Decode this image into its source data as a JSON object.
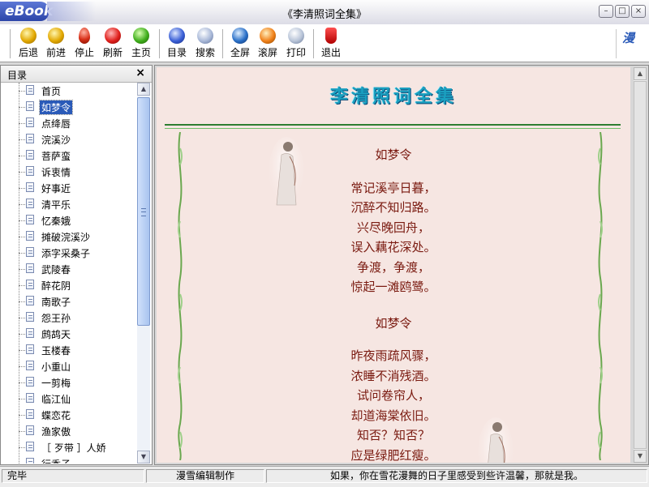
{
  "window": {
    "logo": "eBook",
    "title": "《李清照词全集》",
    "buttons": {
      "minimize": "–",
      "maximize": "□",
      "close": "×"
    }
  },
  "toolbar": {
    "items": [
      {
        "label": "后退",
        "icon": "back-icon"
      },
      {
        "label": "前进",
        "icon": "forward-icon"
      },
      {
        "label": "停止",
        "icon": "stop-icon"
      },
      {
        "label": "刷新",
        "icon": "refresh-icon"
      },
      {
        "label": "主页",
        "icon": "home-icon"
      },
      {
        "label": "目录",
        "icon": "toc-icon"
      },
      {
        "label": "搜索",
        "icon": "search-icon"
      },
      {
        "label": "全屏",
        "icon": "fullscreen-icon"
      },
      {
        "label": "滚屏",
        "icon": "autoscroll-icon"
      },
      {
        "label": "打印",
        "icon": "print-icon"
      },
      {
        "label": "退出",
        "icon": "exit-icon"
      }
    ],
    "brand_glyph": "漫"
  },
  "sidebar": {
    "title": "目录",
    "close": "×",
    "items": [
      "首页",
      "如梦令",
      "点绛唇",
      "浣溪沙",
      "菩萨蛮",
      "诉衷情",
      "好事近",
      "清平乐",
      "忆秦娥",
      "摊破浣溪沙",
      "添字采桑子",
      "武陵春",
      "醉花阴",
      "南歌子",
      "怨王孙",
      "鹧鸪天",
      "玉楼春",
      "小重山",
      "一剪梅",
      "临江仙",
      "蝶恋花",
      "渔家傲",
      "［ 歹带 ］人娇",
      "行香子"
    ],
    "selected_index": 1
  },
  "content": {
    "book_title": "李清照词全集",
    "poems": [
      {
        "title": "如梦令",
        "lines": [
          "常记溪亭日暮，",
          "沉醉不知归路。",
          "兴尽晚回舟，",
          "误入藕花深处。",
          "争渡，争渡，",
          "惊起一滩鸥鹭。"
        ]
      },
      {
        "title": "如梦令",
        "lines": [
          "昨夜雨疏风骤，",
          "浓睡不消残酒。",
          "试问卷帘人，",
          "却道海棠依旧。",
          "知否？知否？",
          "应是绿肥红瘦。"
        ]
      }
    ]
  },
  "status": {
    "left": "完毕",
    "middle": "漫雪编辑制作",
    "right": "如果，你在雪花漫舞的日子里感受到些许温馨，那就是我。"
  }
}
